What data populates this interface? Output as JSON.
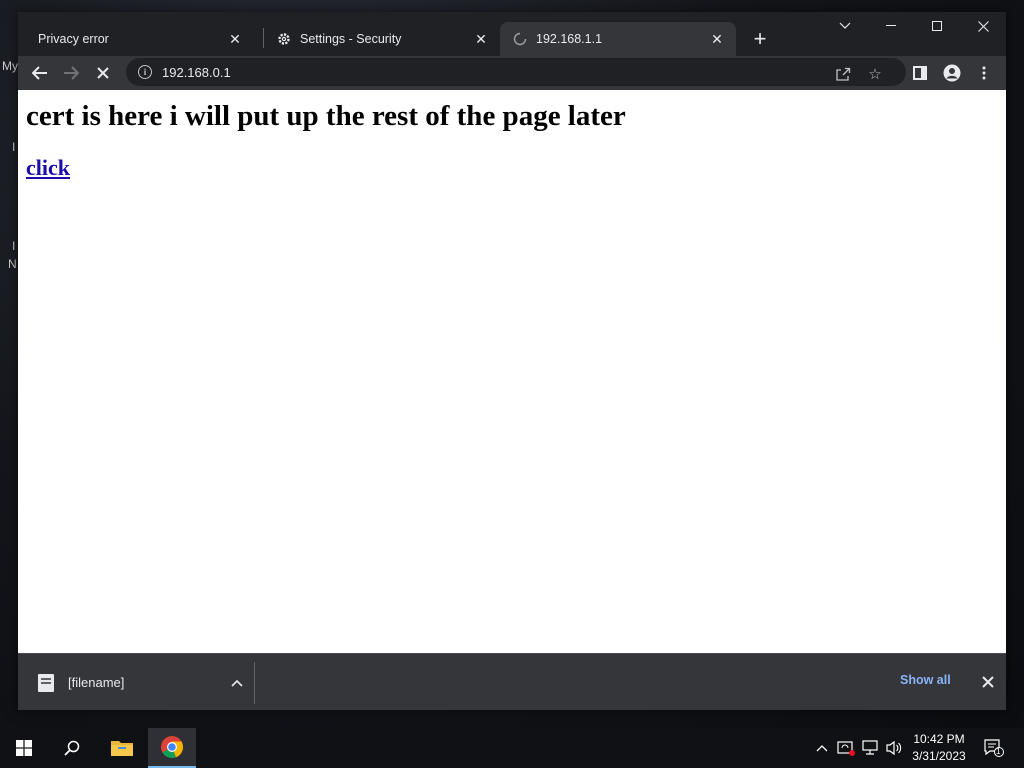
{
  "desktop": {
    "label_1": "My",
    "label_2": "I",
    "label_3": "N"
  },
  "tabs": [
    {
      "title": "Privacy error",
      "icon": "none",
      "active": false
    },
    {
      "title": "Settings - Security",
      "icon": "gear-icon",
      "active": false
    },
    {
      "title": "192.168.1.1",
      "icon": "loading-spinner-icon",
      "active": true
    }
  ],
  "toolbar": {
    "url": "192.168.0.1"
  },
  "page": {
    "heading": "cert is here i will put up the rest of the page later",
    "link_text": "click"
  },
  "downloads": {
    "file_name": "[filename]",
    "show_all": "Show all"
  },
  "taskbar": {
    "time": "10:42 PM",
    "date": "3/31/2023",
    "notification_count": "1"
  },
  "colors": {
    "accent": "#8ab4f8",
    "link": "#1a0dab",
    "chrome_dark": "#202124",
    "chrome_toolbar": "#35363a"
  }
}
